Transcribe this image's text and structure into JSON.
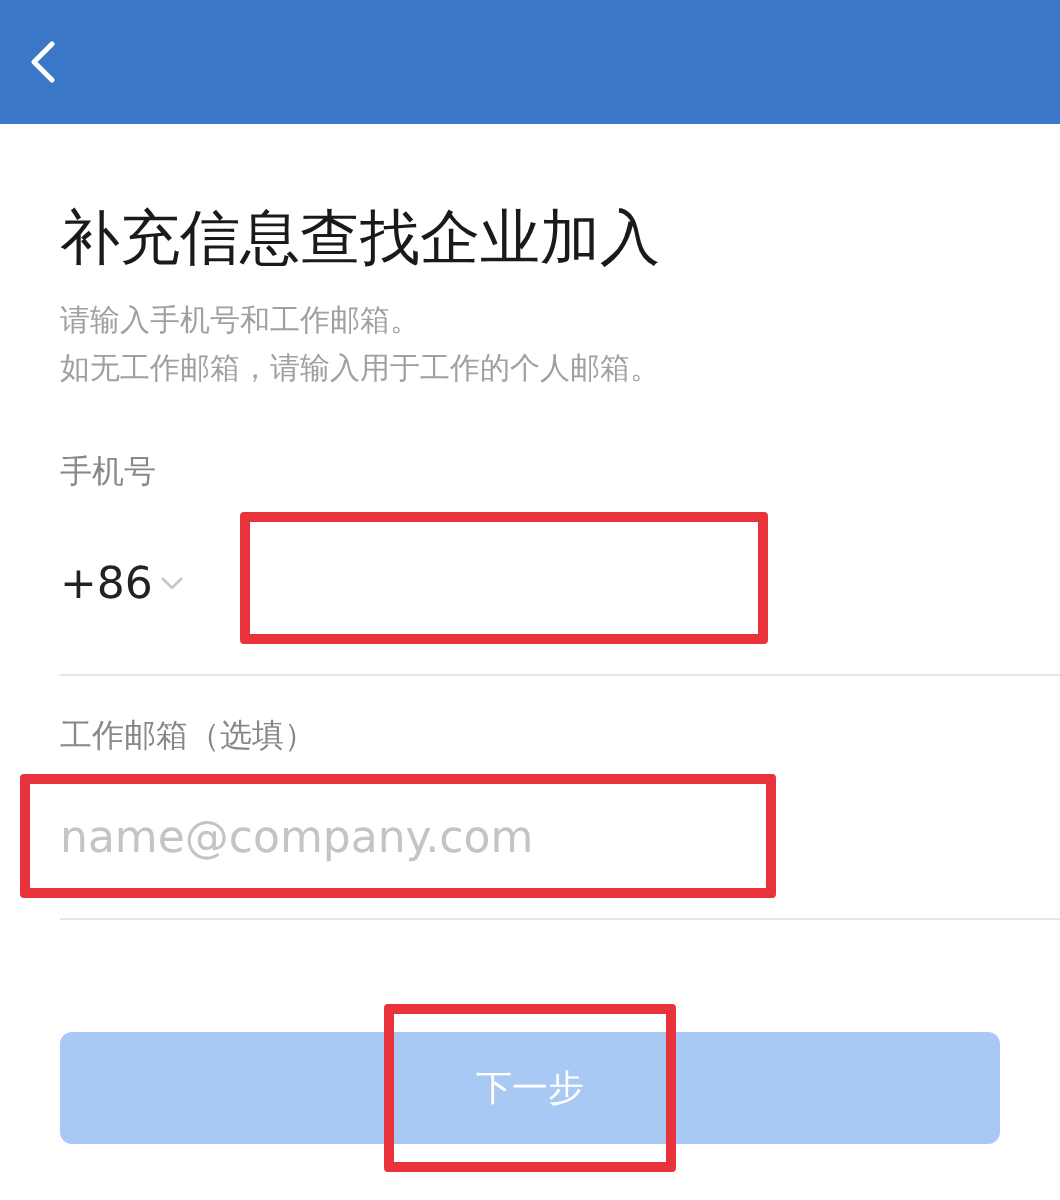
{
  "title": "补充信息查找企业加入",
  "subtitle_lines": [
    "请输入手机号和工作邮箱。",
    "如无工作邮箱，请输入用于工作的个人邮箱。"
  ],
  "phone": {
    "label": "手机号",
    "country_code": "+86",
    "highlighted": true
  },
  "email": {
    "label": "工作邮箱（选填）",
    "placeholder": "name@company.com",
    "highlighted": true
  },
  "next_button": {
    "label": "下一步",
    "disabled": true,
    "highlighted": true
  }
}
